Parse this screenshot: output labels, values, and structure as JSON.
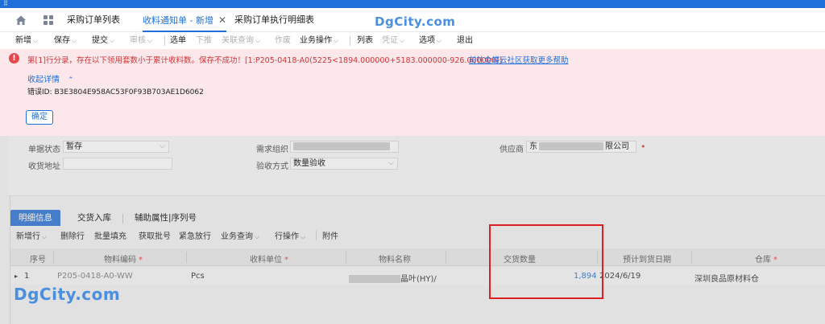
{
  "tabs": [
    {
      "label": "采购订单列表",
      "active": false
    },
    {
      "label": "收料通知单 - 新增",
      "active": true
    },
    {
      "label": "采购订单执行明细表",
      "active": false
    }
  ],
  "watermark": "DgCity.com",
  "toolbar": [
    {
      "label": "新增",
      "disabled": false,
      "dropdown": true
    },
    {
      "label": "保存",
      "disabled": false,
      "dropdown": true
    },
    {
      "label": "提交",
      "disabled": false,
      "dropdown": true
    },
    {
      "label": "审核",
      "disabled": true,
      "dropdown": true
    },
    {
      "label": "选单",
      "disabled": false,
      "dropdown": false
    },
    {
      "label": "下推",
      "disabled": true,
      "dropdown": false
    },
    {
      "label": "关联查询",
      "disabled": true,
      "dropdown": true
    },
    {
      "label": "作废",
      "disabled": true,
      "dropdown": false
    },
    {
      "label": "业务操作",
      "disabled": false,
      "dropdown": true
    },
    {
      "label": "列表",
      "disabled": false,
      "dropdown": false
    },
    {
      "label": "凭证",
      "disabled": true,
      "dropdown": true
    },
    {
      "label": "选项",
      "disabled": false,
      "dropdown": true
    },
    {
      "label": "退出",
      "disabled": false,
      "dropdown": false
    }
  ],
  "error": {
    "message": "第[1]行分录，存在以下领用套数小于累计收料数。保存不成功！[1:P205-0418-A0(5225<1894.000000+5183.000000-926.000000)]",
    "help_link": "前往金蝶云社区获取更多帮助",
    "collapse_label": "收起详情",
    "error_id": "错误ID: B3E3804E958AC53F0F93B703AE1D6062",
    "ok_button": "确定"
  },
  "form": {
    "status_label": "单据状态",
    "status_value": "暂存",
    "address_label": "收货地址",
    "demand_org_label": "需求组织",
    "inspect_label": "验收方式",
    "inspect_value": "数量验收",
    "supplier_label": "供应商",
    "supplier_prefix": "东",
    "supplier_suffix": "限公司"
  },
  "detail_tabs": [
    "明细信息",
    "交货入库",
    "辅助属性|序列号"
  ],
  "detail_toolbar": [
    "新增行",
    "删除行",
    "批量填充",
    "获取批号",
    "紧急放行",
    "业务查询",
    "行操作",
    "附件"
  ],
  "grid": {
    "headers": [
      "序号",
      "物料编码",
      "收料单位",
      "物料名称",
      "交货数量",
      "预计到货日期",
      "仓库"
    ],
    "required": [
      false,
      true,
      true,
      false,
      false,
      false,
      true
    ],
    "row": {
      "index": "1",
      "material_code": "P205-0418-A0-WW",
      "unit": "Pcs",
      "material_name_tail": "晶叶(HY)/",
      "qty": "1,894",
      "date": "2024/6/19",
      "warehouse": "深圳良品原材料仓"
    }
  }
}
